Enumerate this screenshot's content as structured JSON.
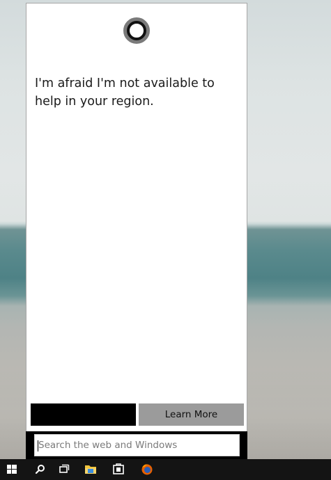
{
  "cortana": {
    "message": "I'm afraid I'm not available to help in your region.",
    "learn_more_label": "Learn More",
    "black_button_label": ""
  },
  "search": {
    "placeholder": "Search the web and Windows",
    "value": ""
  },
  "taskbar": {
    "items": [
      {
        "name": "start",
        "icon": "windows-logo-icon"
      },
      {
        "name": "search",
        "icon": "search-icon"
      },
      {
        "name": "task-view",
        "icon": "task-view-icon"
      },
      {
        "name": "file-explorer",
        "icon": "folder-icon"
      },
      {
        "name": "store",
        "icon": "store-icon"
      },
      {
        "name": "firefox",
        "icon": "firefox-icon"
      }
    ]
  },
  "colors": {
    "taskbar_bg": "#141414",
    "panel_bg": "#ffffff",
    "learn_more_bg": "#9b9b9b",
    "black_button_bg": "#000000",
    "cortana_ring_outer": "#7a7a7a",
    "cortana_ring_inner": "#111111"
  }
}
